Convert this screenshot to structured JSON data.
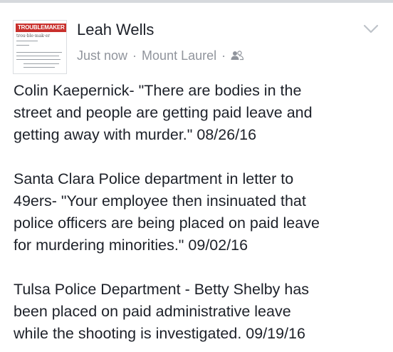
{
  "post": {
    "author": "Leah Wells",
    "avatar": {
      "brand": "TROUBLEMAKER",
      "pronunciation": "trou·ble·mak·er",
      "brand_color": "#c9302c"
    },
    "meta": {
      "time": "Just now",
      "separator": "·",
      "location": "Mount Laurel",
      "audience_icon": "friends-icon"
    },
    "menu_icon": "chevron-down-icon",
    "paragraphs": [
      {
        "lines": [
          "Colin Kaepernick- \"There are bodies in the",
          "street and people are getting paid leave and",
          "getting away with murder.\" 08/26/16"
        ]
      },
      {
        "lines": [
          "Santa Clara Police department in letter to",
          "49ers- \"Your employee then insinuated that",
          "police officers are being placed on paid leave",
          "for murdering minorities.\" 09/02/16"
        ]
      },
      {
        "lines": [
          "Tulsa Police Department - Betty Shelby has",
          "been placed on paid administrative leave",
          "while the shooting is investigated. 09/19/16"
        ]
      }
    ]
  },
  "colors": {
    "text": "#1d2129",
    "meta": "#90949c",
    "border": "#d6d9dd"
  }
}
